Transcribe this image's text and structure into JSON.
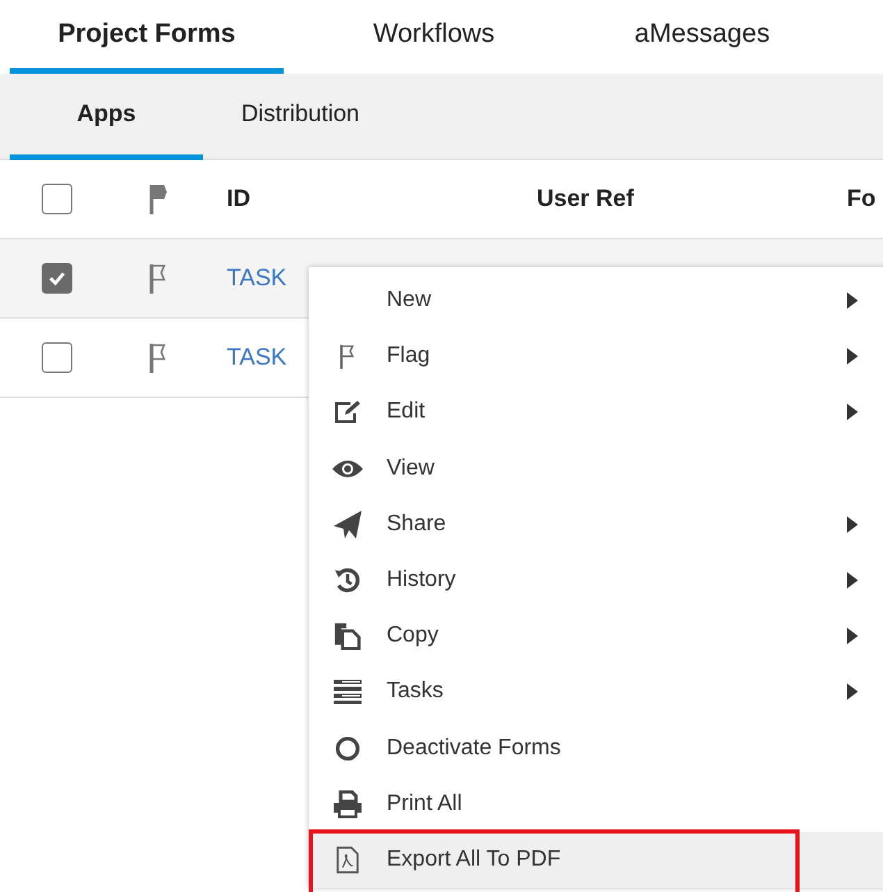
{
  "tabs": [
    {
      "label": "Project Forms",
      "selected": true
    },
    {
      "label": "Workflows",
      "selected": false
    },
    {
      "label": "aMessages",
      "selected": false
    }
  ],
  "subtabs": [
    {
      "label": "Apps",
      "selected": true
    },
    {
      "label": "Distribution",
      "selected": false
    }
  ],
  "table": {
    "header": {
      "checked": false,
      "columns": [
        "ID",
        "User Ref",
        "Fo"
      ]
    },
    "rows": [
      {
        "checked": true,
        "id": "TASK"
      },
      {
        "checked": false,
        "id": "TASK"
      }
    ]
  },
  "context_menu": {
    "items": [
      {
        "label": "New",
        "submenu": true,
        "selected": false
      },
      {
        "label": "Flag",
        "submenu": true,
        "selected": false
      },
      {
        "label": "Edit",
        "submenu": true,
        "selected": false
      },
      {
        "label": "View",
        "submenu": false,
        "selected": false
      },
      {
        "label": "Share",
        "submenu": true,
        "selected": false
      },
      {
        "label": "History",
        "submenu": true,
        "selected": false
      },
      {
        "label": "Copy",
        "submenu": true,
        "selected": false
      },
      {
        "label": "Tasks",
        "submenu": true,
        "selected": false
      },
      {
        "label": "Deactivate Forms",
        "submenu": false,
        "selected": false
      },
      {
        "label": "Print All",
        "submenu": false,
        "selected": false
      },
      {
        "label": "Export All To PDF",
        "submenu": false,
        "selected": true
      }
    ]
  }
}
